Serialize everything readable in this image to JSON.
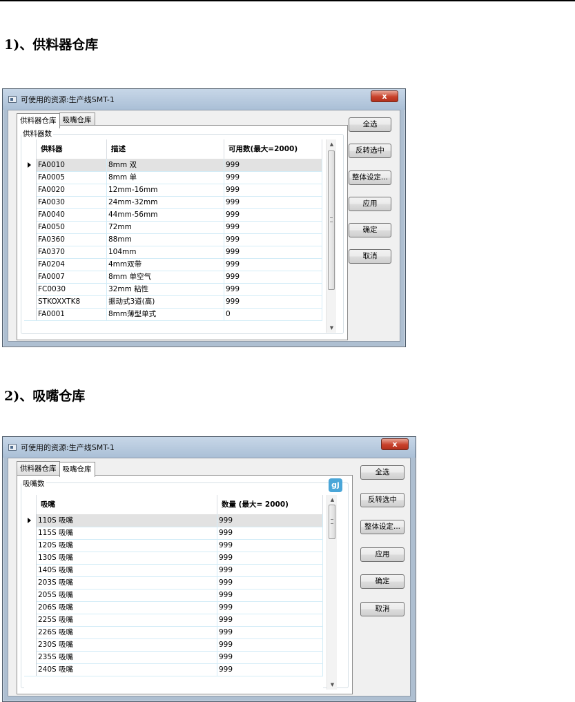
{
  "headings": {
    "section1": "1)、供料器仓库",
    "section2": "2)、吸嘴仓库"
  },
  "window1": {
    "title": "可使用的资源:生产线SMT-1",
    "tabs": [
      "供料器仓库",
      "吸嘴仓库"
    ],
    "active_tab": 0,
    "group_label": "供料器数",
    "columns": [
      "供料器",
      "描述",
      "可用数(最大=2000)"
    ],
    "rows": [
      [
        "FA0010",
        "8mm 双",
        "999"
      ],
      [
        "FA0005",
        "8mm 单",
        "999"
      ],
      [
        "FA0020",
        "12mm-16mm",
        "999"
      ],
      [
        "FA0030",
        "24mm-32mm",
        "999"
      ],
      [
        "FA0040",
        "44mm-56mm",
        "999"
      ],
      [
        "FA0050",
        "72mm",
        "999"
      ],
      [
        "FA0360",
        "88mm",
        "999"
      ],
      [
        "FA0370",
        "104mm",
        "999"
      ],
      [
        "FA0204",
        "4mm双带",
        "999"
      ],
      [
        "FA0007",
        "8mm 单空气",
        "999"
      ],
      [
        "FC0030",
        "32mm 粘性",
        "999"
      ],
      [
        "STKOXXTK8",
        "振动式3道(高)",
        "999"
      ],
      [
        "FA0001",
        "8mm薄型单式",
        "0"
      ]
    ],
    "buttons": [
      "全选",
      "反转选中",
      "整体设定...",
      "应用",
      "确定",
      "取消"
    ]
  },
  "window2": {
    "title": "可使用的资源:生产线SMT-1",
    "tabs": [
      "供料器仓库",
      "吸嘴仓库"
    ],
    "active_tab": 1,
    "group_label": "吸嘴数",
    "badge": "gj",
    "columns": [
      "吸嘴",
      "数量 (最大= 2000)"
    ],
    "rows": [
      [
        "110S 吸嘴",
        "999"
      ],
      [
        "115S 吸嘴",
        "999"
      ],
      [
        "120S 吸嘴",
        "999"
      ],
      [
        "130S 吸嘴",
        "999"
      ],
      [
        "140S 吸嘴",
        "999"
      ],
      [
        "203S 吸嘴",
        "999"
      ],
      [
        "205S 吸嘴",
        "999"
      ],
      [
        "206S 吸嘴",
        "999"
      ],
      [
        "225S 吸嘴",
        "999"
      ],
      [
        "226S 吸嘴",
        "999"
      ],
      [
        "230S 吸嘴",
        "999"
      ],
      [
        "235S 吸嘴",
        "999"
      ],
      [
        "240S 吸嘴",
        "999"
      ]
    ],
    "buttons": [
      "全选",
      "反转选中",
      "整体设定...",
      "应用",
      "确定",
      "取消"
    ]
  },
  "close_label": "x"
}
